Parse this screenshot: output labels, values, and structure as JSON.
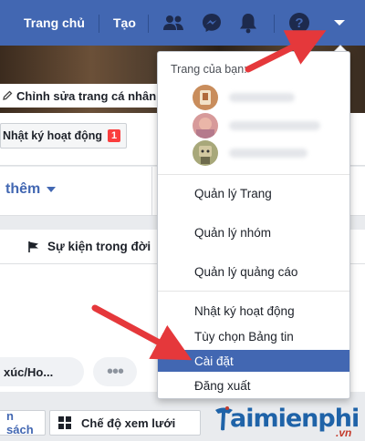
{
  "nav": {
    "home_label": "Trang chủ",
    "create_label": "Tạo",
    "icons": [
      "friends-icon",
      "messenger-icon",
      "notifications-icon",
      "help-icon",
      "account-menu-icon"
    ]
  },
  "profile": {
    "edit_cover_label": "Chỉnh sửa trang cá nhân",
    "activity_log_label": "Nhật ký hoạt động",
    "activity_count": "1",
    "more_label": "thêm",
    "life_event_label": "Sự kiện trong đời",
    "feeling_label": "xúc/Ho...",
    "more_options_label": "•••",
    "album_label": "n sách",
    "grid_view_label": "Chế độ xem lưới"
  },
  "dropdown": {
    "header": "Trang của bạn:",
    "pages": [
      {
        "avatar_color": "#c98d5c"
      },
      {
        "avatar_color": "#d79a9a"
      },
      {
        "avatar_color": "#a8a87a"
      }
    ],
    "group1": [
      "Quản lý Trang",
      "Quản lý nhóm",
      "Quản lý quảng cáo"
    ],
    "group2": [
      "Nhật ký hoạt động",
      "Tùy chọn Bảng tin",
      "Cài đặt",
      "Đăng xuất"
    ],
    "active_item": "Cài đặt"
  },
  "watermark": {
    "brand": "aimienphi",
    "suffix": ".vn"
  },
  "colors": {
    "nav_blue": "#4267b2",
    "highlight": "#4267b2",
    "arrow_red": "#e5383b",
    "badge_red": "#fa3e3e"
  }
}
